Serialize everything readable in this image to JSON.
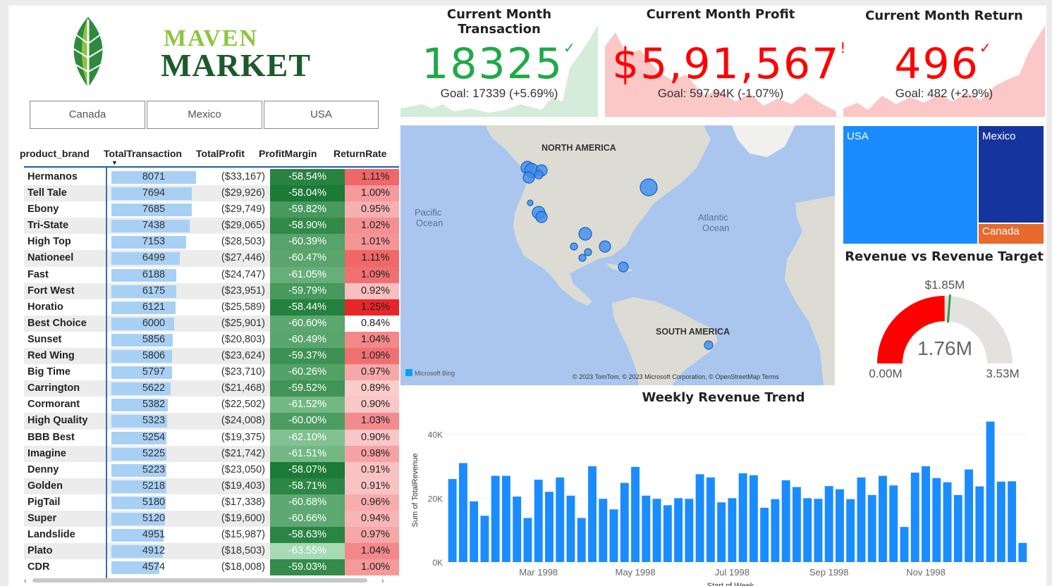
{
  "logo": {
    "line1": "MAVEN",
    "line2": "MARKET"
  },
  "slicer": {
    "options": [
      "Canada",
      "Mexico",
      "USA"
    ]
  },
  "table": {
    "headers": [
      "product_brand",
      "TotalTransaction",
      "TotalProfit",
      "ProfitMargin",
      "ReturnRate"
    ],
    "rows": [
      {
        "brand": "Hermanos",
        "txn": "8071",
        "profit": "($33,167)",
        "margin": "-58.54%",
        "return": "1.11%"
      },
      {
        "brand": "Tell Tale",
        "txn": "7694",
        "profit": "($29,926)",
        "margin": "-58.04%",
        "return": "1.00%"
      },
      {
        "brand": "Ebony",
        "txn": "7685",
        "profit": "($29,749)",
        "margin": "-59.82%",
        "return": "0.95%"
      },
      {
        "brand": "Tri-State",
        "txn": "7438",
        "profit": "($29,065)",
        "margin": "-58.90%",
        "return": "1.02%"
      },
      {
        "brand": "High Top",
        "txn": "7153",
        "profit": "($28,503)",
        "margin": "-60.39%",
        "return": "1.01%"
      },
      {
        "brand": "Nationeel",
        "txn": "6499",
        "profit": "($27,446)",
        "margin": "-60.47%",
        "return": "1.11%"
      },
      {
        "brand": "Fast",
        "txn": "6188",
        "profit": "($24,747)",
        "margin": "-61.05%",
        "return": "1.09%"
      },
      {
        "brand": "Fort West",
        "txn": "6175",
        "profit": "($23,951)",
        "margin": "-59.79%",
        "return": "0.92%"
      },
      {
        "brand": "Horatio",
        "txn": "6121",
        "profit": "($25,589)",
        "margin": "-58.44%",
        "return": "1.25%"
      },
      {
        "brand": "Best Choice",
        "txn": "6000",
        "profit": "($25,901)",
        "margin": "-60.60%",
        "return": "0.84%"
      },
      {
        "brand": "Sunset",
        "txn": "5856",
        "profit": "($20,803)",
        "margin": "-60.49%",
        "return": "1.04%"
      },
      {
        "brand": "Red Wing",
        "txn": "5806",
        "profit": "($23,624)",
        "margin": "-59.37%",
        "return": "1.09%"
      },
      {
        "brand": "Big Time",
        "txn": "5797",
        "profit": "($23,710)",
        "margin": "-60.26%",
        "return": "0.97%"
      },
      {
        "brand": "Carrington",
        "txn": "5622",
        "profit": "($21,468)",
        "margin": "-59.52%",
        "return": "0.89%"
      },
      {
        "brand": "Cormorant",
        "txn": "5382",
        "profit": "($22,502)",
        "margin": "-61.52%",
        "return": "0.90%"
      },
      {
        "brand": "High Quality",
        "txn": "5323",
        "profit": "($24,008)",
        "margin": "-60.00%",
        "return": "1.03%"
      },
      {
        "brand": "BBB Best",
        "txn": "5254",
        "profit": "($19,375)",
        "margin": "-62.10%",
        "return": "0.90%"
      },
      {
        "brand": "Imagine",
        "txn": "5225",
        "profit": "($21,742)",
        "margin": "-61.51%",
        "return": "0.98%"
      },
      {
        "brand": "Denny",
        "txn": "5223",
        "profit": "($23,050)",
        "margin": "-58.07%",
        "return": "0.91%"
      },
      {
        "brand": "Golden",
        "txn": "5218",
        "profit": "($19,403)",
        "margin": "-58.71%",
        "return": "0.91%"
      },
      {
        "brand": "PigTail",
        "txn": "5180",
        "profit": "($17,338)",
        "margin": "-60.68%",
        "return": "0.96%"
      },
      {
        "brand": "Super",
        "txn": "5120",
        "profit": "($19,600)",
        "margin": "-60.66%",
        "return": "0.94%"
      },
      {
        "brand": "Landslide",
        "txn": "4951",
        "profit": "($15,987)",
        "margin": "-58.63%",
        "return": "0.97%"
      },
      {
        "brand": "Plato",
        "txn": "4912",
        "profit": "($18,503)",
        "margin": "-63.55%",
        "return": "1.04%"
      },
      {
        "brand": "CDR",
        "txn": "4574",
        "profit": "($18,008)",
        "margin": "-59.03%",
        "return": "1.00%"
      }
    ]
  },
  "kpis": {
    "transaction": {
      "title": "Current Month Transaction",
      "value": "18325",
      "mark": "✓",
      "goal": "Goal: 17339 (+5.69%)",
      "color": "#1faa48",
      "fill": "#d4ecd9"
    },
    "profit": {
      "title": "Current Month Profit",
      "value": "$5,91,567",
      "mark": "!",
      "goal": "Goal: 597.94K (-1.07%)",
      "color": "#ff0000",
      "fill": "#fbc7c7"
    },
    "return": {
      "title": "Current Month Return",
      "value": "496",
      "mark": "✓",
      "goal": "Goal: 482 (+2.9%)",
      "color": "#ff0000",
      "fill": "#fbc7c7"
    }
  },
  "map": {
    "labels": {
      "north_america": "NORTH AMERICA",
      "south_america": "SOUTH AMERICA",
      "pacific": [
        "Pacific",
        "Ocean"
      ],
      "atlantic": [
        "Atlantic",
        "Ocean"
      ]
    },
    "bing": "Microsoft Bing",
    "copyright": "© 2023 TomTom, © 2023 Microsoft Corporation, © OpenStreetMap  Terms"
  },
  "treemap": {
    "usa": "USA",
    "mexico": "Mexico",
    "canada": "Canada"
  },
  "gauge": {
    "title": "Revenue vs Revenue Target",
    "value": "1.76M",
    "min": "0.00M",
    "max": "3.53M",
    "target": "$1.85M",
    "fraction": 0.4986
  },
  "weekly": {
    "title": "Weekly Revenue Trend",
    "chart_data": {
      "type": "bar",
      "xlabel": "Start of Week",
      "ylabel": "Sum of TotalRevenue",
      "ylim": [
        0,
        45000
      ],
      "yticks": [
        "0K",
        "20K",
        "40K"
      ],
      "xticks": [
        "Mar 1998",
        "May 1998",
        "Jul 1998",
        "Sep 1998",
        "Nov 1998"
      ],
      "values": [
        26000,
        31000,
        19000,
        14500,
        27000,
        27000,
        20500,
        13800,
        25800,
        22000,
        26500,
        20800,
        13800,
        30000,
        19800,
        16500,
        24800,
        29800,
        20800,
        19800,
        17800,
        20000,
        19800,
        27500,
        26500,
        18700,
        20000,
        27800,
        27200,
        17000,
        19700,
        25600,
        23500,
        20000,
        19800,
        23800,
        22800,
        19700,
        26500,
        21000,
        27000,
        24000,
        11000,
        28000,
        30000,
        26300,
        25000,
        21000,
        29000,
        23700,
        44000,
        25200,
        25300,
        6000
      ]
    }
  },
  "colors": {
    "margin_dark": "#1b7a36",
    "margin_light": "#a7dbb3",
    "return_dark": "#e8262a",
    "return_light": "#fde3e3",
    "bar": "#1a8cff"
  }
}
